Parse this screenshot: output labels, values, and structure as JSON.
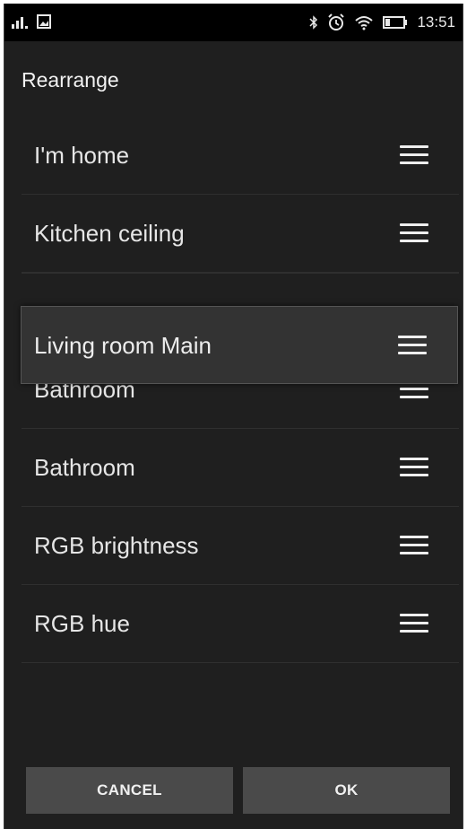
{
  "status_bar": {
    "time": "13:51",
    "icons": [
      "signal-icon",
      "image-notification-icon",
      "bluetooth-icon",
      "alarm-icon",
      "wifi-icon",
      "battery-icon"
    ]
  },
  "dialog": {
    "title": "Rearrange",
    "items": [
      {
        "label": "I'm home"
      },
      {
        "label": "Kitchen ceiling"
      },
      {
        "label": "Bathroom"
      },
      {
        "label": "Bathroom"
      },
      {
        "label": "RGB brightness"
      },
      {
        "label": "RGB hue"
      }
    ],
    "dragged_item": {
      "label": "Living room Main"
    },
    "buttons": {
      "cancel": "CANCEL",
      "ok": "OK"
    }
  },
  "colors": {
    "background": "#1f1f1f",
    "status_bar": "#000000",
    "button": "#4a4a4a",
    "dragged_row": "#333333"
  }
}
